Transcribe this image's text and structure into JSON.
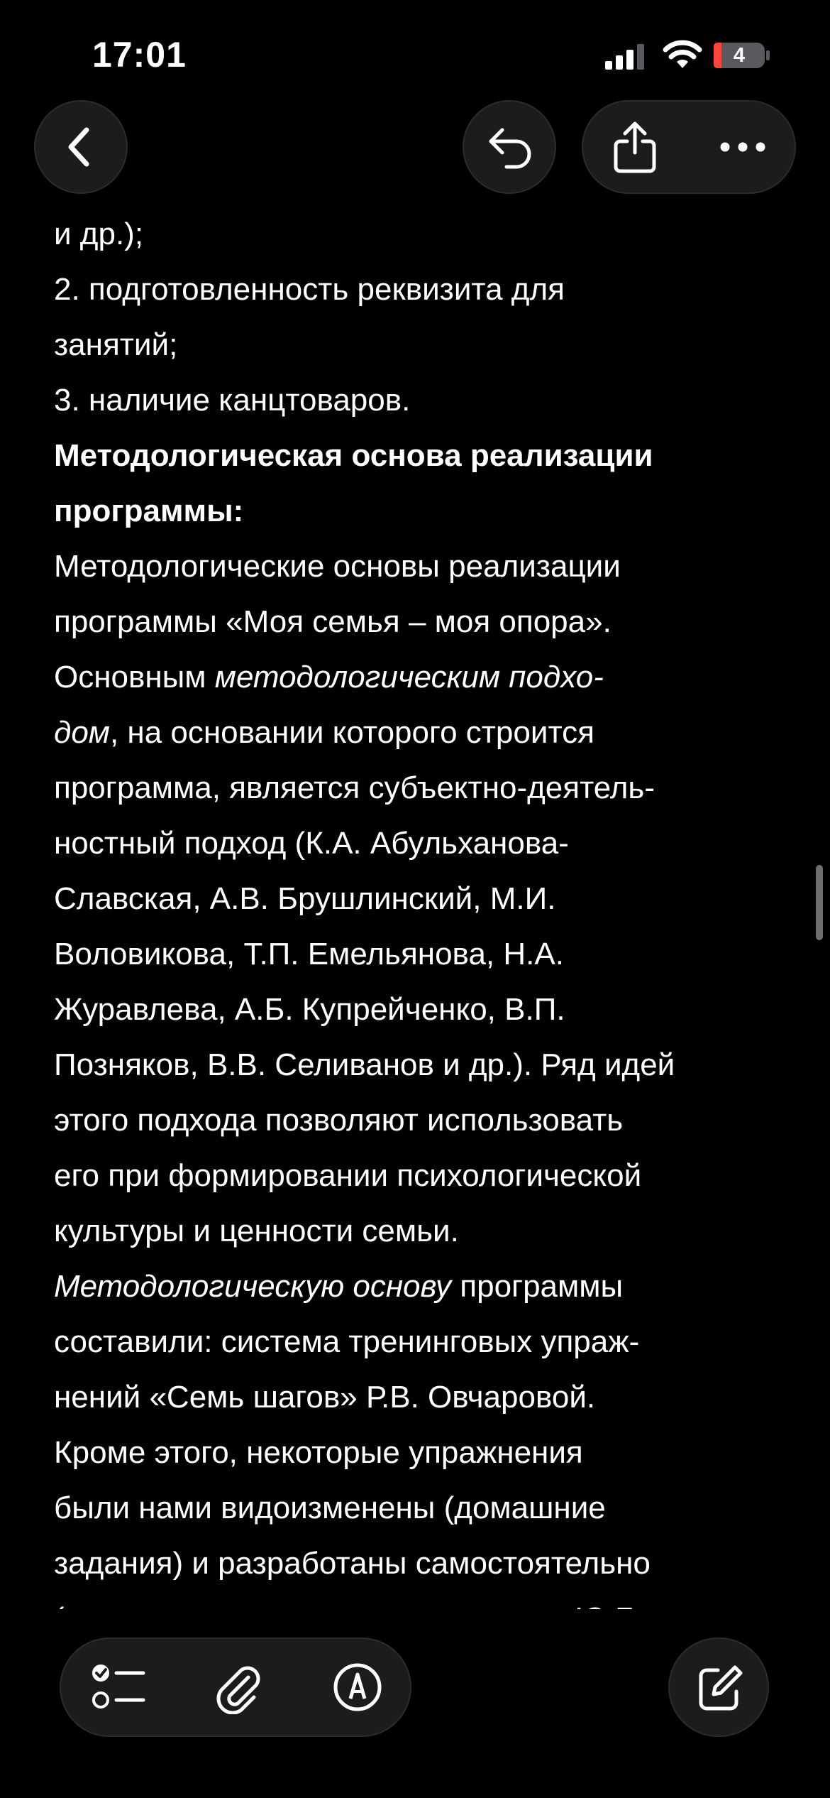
{
  "status_bar": {
    "time": "17:01",
    "battery_level": "4"
  },
  "note": {
    "lines": [
      [
        {
          "t": "и др.);"
        }
      ],
      [
        {
          "t": "2. подготовленность реквизита для"
        }
      ],
      [
        {
          "t": "занятий;"
        }
      ],
      [
        {
          "t": "3. наличие канцтоваров."
        }
      ],
      [
        {
          "t": "Методологическая основа реализации",
          "b": true
        }
      ],
      [
        {
          "t": "программы:",
          "b": true
        }
      ],
      [
        {
          "t": "Методологические основы реализации"
        }
      ],
      [
        {
          "t": "программы «Моя семья – моя опора»."
        }
      ],
      [
        {
          "t": "Основным "
        },
        {
          "t": "методологическим подхо-",
          "i": true
        }
      ],
      [
        {
          "t": "дом",
          "i": true
        },
        {
          "t": ", на основании которого строится"
        }
      ],
      [
        {
          "t": "программа, является субъектно-деятель-"
        }
      ],
      [
        {
          "t": "ностный подход (К.А. Абульханова-"
        }
      ],
      [
        {
          "t": "Славская, А.В. Брушлинский, М.И."
        }
      ],
      [
        {
          "t": "Воловикова, Т.П. Емельянова, Н.А."
        }
      ],
      [
        {
          "t": "Журавлева, А.Б. Купрейченко, В.П."
        }
      ],
      [
        {
          "t": "Позняков, В.В. Селиванов и др.). Ряд идей"
        }
      ],
      [
        {
          "t": "этого подхода позволяют использовать"
        }
      ],
      [
        {
          "t": "его при формировании психологической"
        }
      ],
      [
        {
          "t": "культуры и ценности семьи."
        }
      ],
      [
        {
          "t": "Методологическую основу",
          "i": true
        },
        {
          "t": " программы"
        }
      ],
      [
        {
          "t": "составили: система тренинговых упраж-"
        }
      ],
      [
        {
          "t": "нений «Семь шагов» Р.В. Овчаровой."
        }
      ],
      [
        {
          "t": "Кроме этого, некоторые упражнения"
        }
      ],
      [
        {
          "t": "были нами видоизменены (домашние"
        }
      ],
      [
        {
          "t": "задания) и разработаны самостоятельно"
        }
      ],
      [
        {
          "t": "(мини-лекции по материалам книги Ю.Б."
        }
      ]
    ]
  },
  "colors": {
    "background": "#000000",
    "text": "#ffffff",
    "button_fill": "#1c1c1e",
    "button_border": "#2c2c2e",
    "battery_low": "#ff453a"
  },
  "icons": {
    "back": "chevron-left-icon",
    "undo": "undo-icon",
    "share": "share-icon",
    "more": "more-icon",
    "checklist": "checklist-icon",
    "attach": "paperclip-icon",
    "markup": "markup-pen-icon",
    "compose": "compose-icon"
  }
}
